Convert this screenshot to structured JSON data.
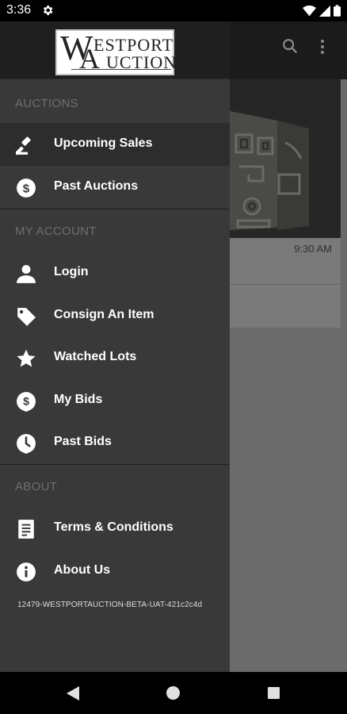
{
  "status_bar": {
    "time": "3:36"
  },
  "logo": {
    "text_line1": "ESTPORT",
    "text_line2": "UCTION",
    "initial1": "W",
    "initial2": "A"
  },
  "background": {
    "card_time": "9:30 AM"
  },
  "drawer": {
    "sections": [
      {
        "label": "AUCTIONS"
      },
      {
        "label": "MY ACCOUNT"
      },
      {
        "label": "ABOUT"
      }
    ],
    "items": [
      {
        "label": "Upcoming Sales",
        "icon": "gavel-icon",
        "active": true
      },
      {
        "label": "Past Auctions",
        "icon": "dollar-circle-icon"
      },
      {
        "label": "Login",
        "icon": "person-icon"
      },
      {
        "label": "Consign An Item",
        "icon": "tag-icon"
      },
      {
        "label": "Watched Lots",
        "icon": "star-icon"
      },
      {
        "label": "My Bids",
        "icon": "dollar-pin-icon"
      },
      {
        "label": "Past Bids",
        "icon": "clock-pin-icon"
      },
      {
        "label": "Terms & Conditions",
        "icon": "document-icon"
      },
      {
        "label": "About Us",
        "icon": "info-icon"
      }
    ],
    "version": "12479-WESTPORTAUCTION-BETA-UAT-421c2c4d"
  },
  "colors": {
    "drawer_bg": "#393939",
    "active_bg": "#2d2d2d",
    "section_label": "#6e6e6e"
  }
}
